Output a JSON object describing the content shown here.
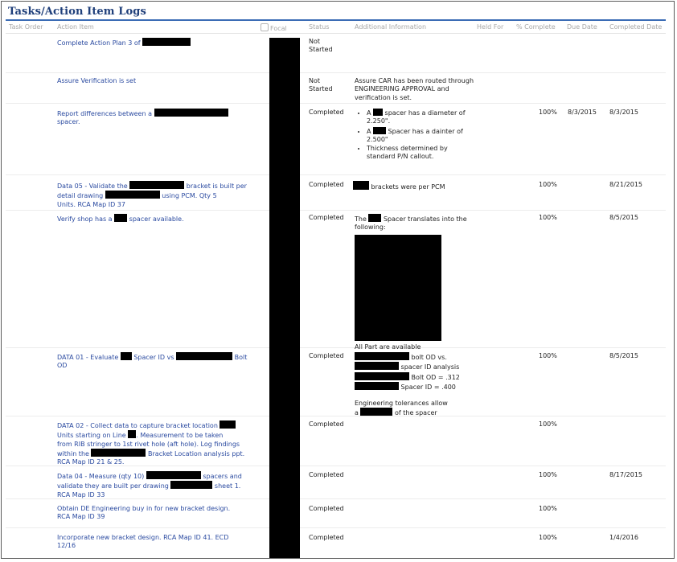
{
  "title": "Tasks/Action Item Logs",
  "columns": [
    "Task Order",
    "Action Item",
    "Focal",
    "Status",
    "Additional Information",
    "Held For",
    "% Complete",
    "Due Date",
    "Completed Date"
  ],
  "rows": [
    {
      "action": [
        "Complete Action Plan 3 of "
      ],
      "status": "Not Started"
    },
    {
      "action": [
        "Assure Verification is set"
      ],
      "status": "Not Started",
      "additional": "Assure CAR has been routed through ENGINEERING APPROVAL and verification is set."
    },
    {
      "action": [
        "Report differences between a ",
        "spacer."
      ],
      "status": "Completed",
      "bullets": [
        [
          "A ",
          " spacer has a diameter of 2.250\"."
        ],
        [
          "A ",
          " Spacer has a dainter of 2.500\""
        ],
        [
          "Thickness determined by standard P/N callout."
        ]
      ],
      "pct": "100%",
      "due": "8/3/2015",
      "completed": "8/3/2015"
    },
    {
      "action": [
        "Data 05 - Validate the ",
        " bracket is built per",
        "detail drawing ",
        " using PCM. Qty 5",
        "Units. RCA Map ID 37"
      ],
      "status": "Completed",
      "additional": " brackets were per PCM",
      "pct": "100%",
      "completed": "8/21/2015"
    },
    {
      "action": [
        "Verify shop has a ",
        " spacer available."
      ],
      "status": "Completed",
      "additional": [
        "The ",
        " Spacer translates into the following:",
        "All Part are available"
      ],
      "pct": "100%",
      "completed": "8/5/2015"
    },
    {
      "action": [
        "DATA 01 - Evaluate ",
        " Spacer ID vs ",
        " Bolt",
        "OD"
      ],
      "status": "Completed",
      "additional": [
        " bolt OD vs.",
        " spacer ID analysis",
        " Bolt OD = .312",
        " Spacer ID = .400",
        "Engineering tolerances allow",
        "a ",
        " of the spacer"
      ],
      "pct": "100%",
      "completed": "8/5/2015"
    },
    {
      "action": [
        "DATA 02 - Collect data to capture bracket location ",
        "Units starting on Line ",
        ". Measurement to be taken",
        "from RIB stringer to 1st rivet hole (aft hole). Log findings",
        "within the ",
        " Bracket Location analysis ppt.",
        "RCA Map ID 21 & 25."
      ],
      "status": "Completed",
      "pct": "100%"
    },
    {
      "action": [
        "Data 04 - Measure (qty 10) ",
        " spacers and",
        "validate they are built per drawing ",
        " sheet 1.",
        "RCA Map ID 33"
      ],
      "status": "Completed",
      "pct": "100%",
      "completed": "8/17/2015"
    },
    {
      "action": [
        "Obtain DE Engineering buy in for new bracket design.",
        "RCA Map ID 39"
      ],
      "status": "Completed",
      "pct": "100%"
    },
    {
      "action": [
        "Incorporate new bracket design. RCA Map ID 41. ECD",
        "12/16"
      ],
      "status": "Completed",
      "pct": "100%",
      "completed": "1/4/2016"
    }
  ]
}
